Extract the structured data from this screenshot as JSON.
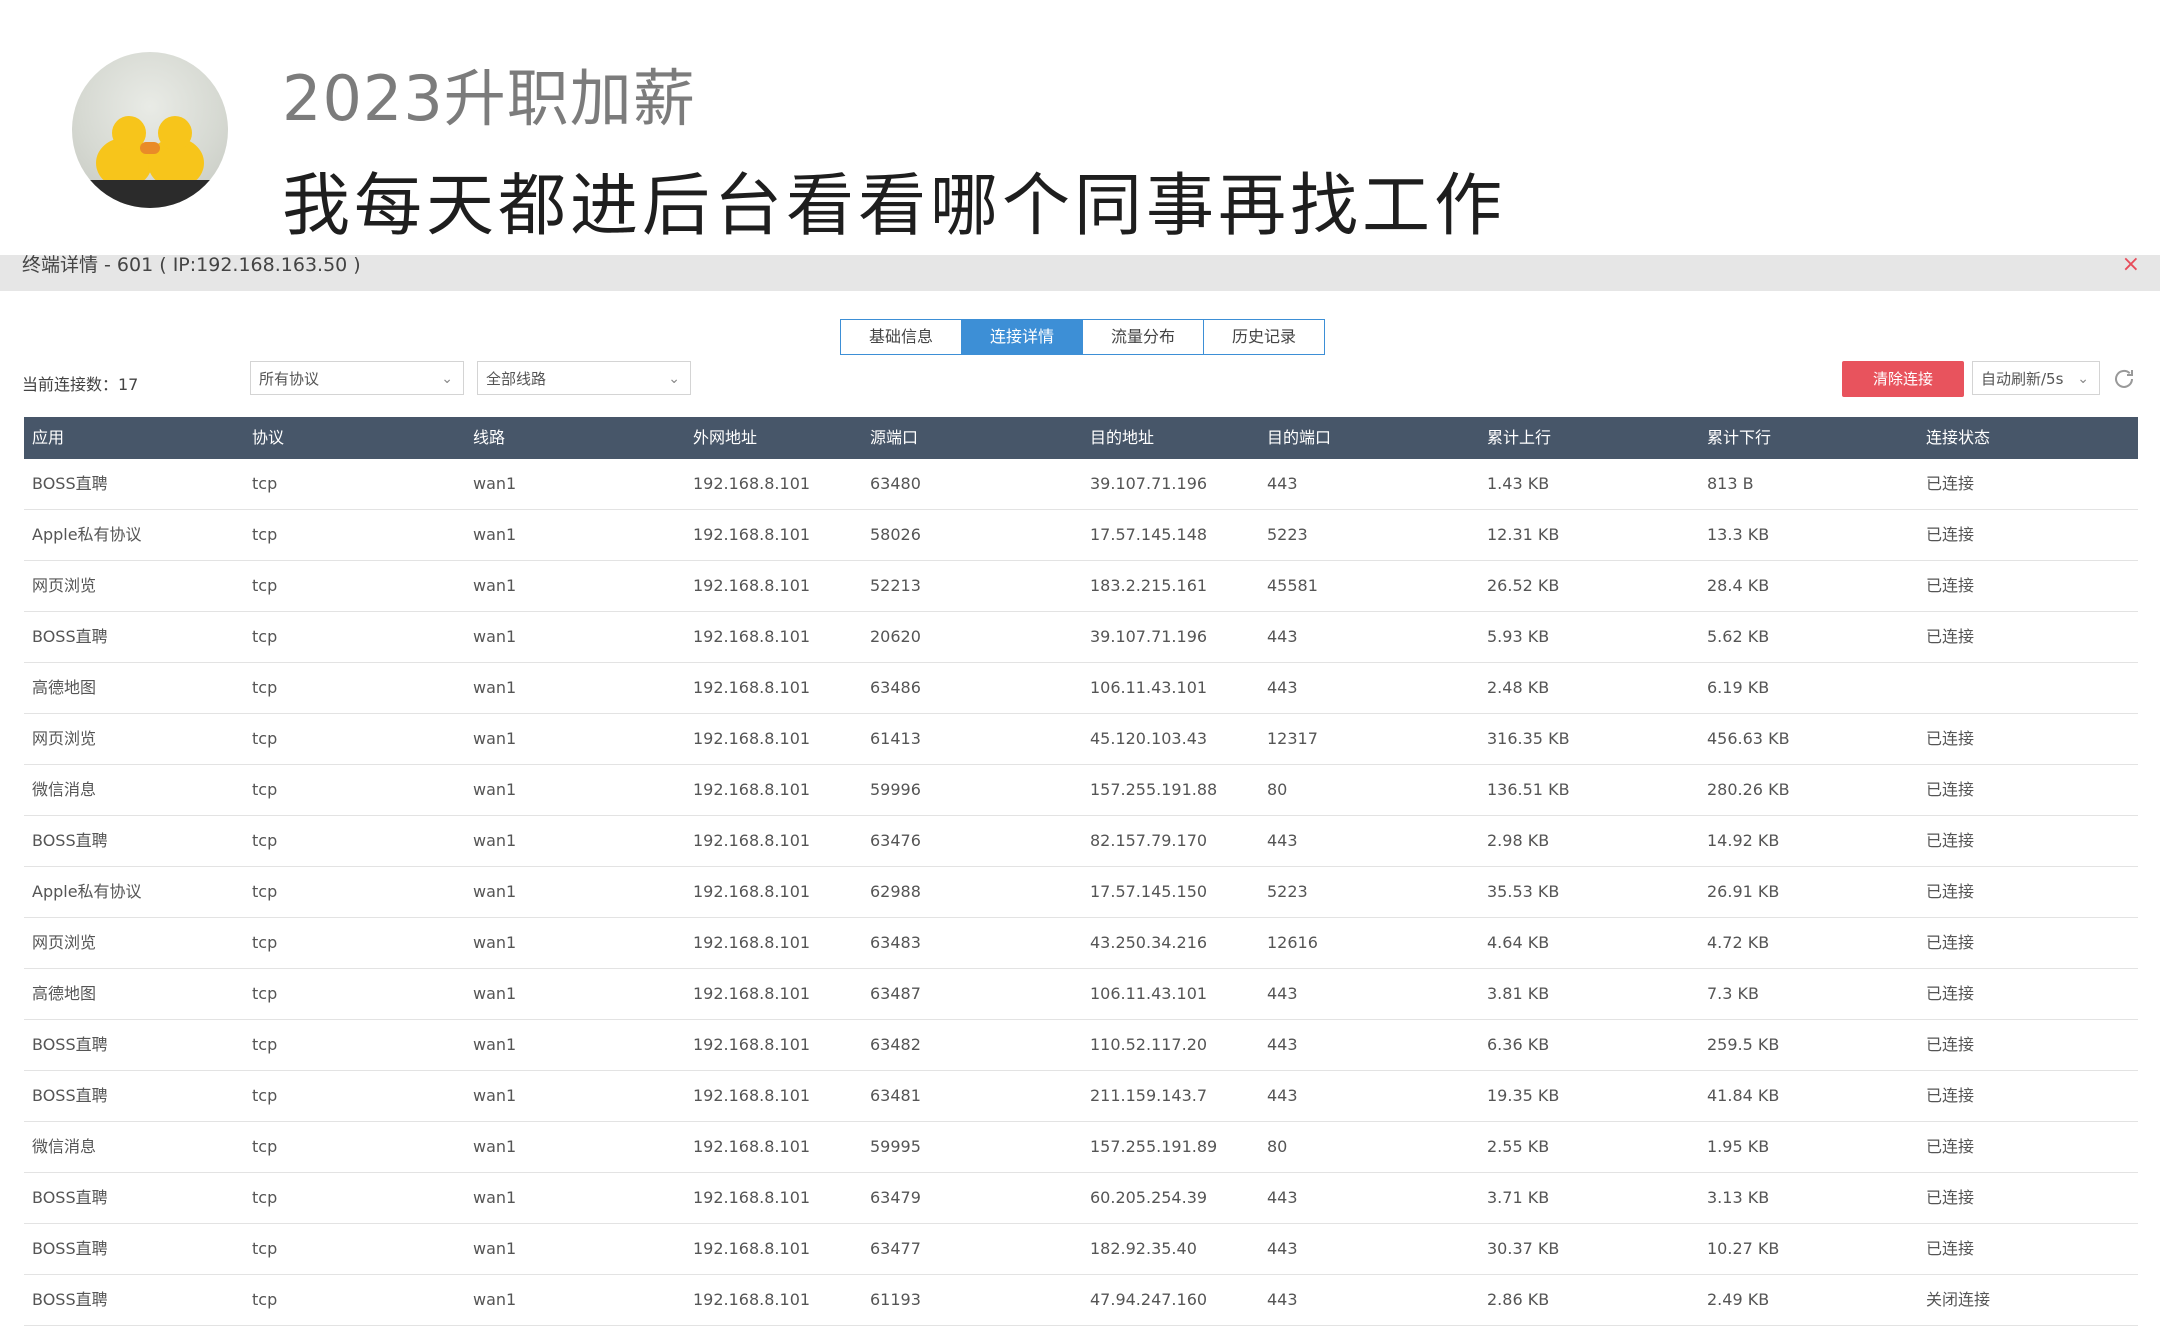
{
  "post": {
    "username": "2023升职加薪",
    "text": "我每天都进后台看看哪个同事再找工作"
  },
  "modal": {
    "title": "终端详情 - 601 ( IP:192.168.163.50 )",
    "close_glyph": "×"
  },
  "tabs": [
    "基础信息",
    "连接详情",
    "流量分布",
    "历史记录"
  ],
  "active_tab": "连接详情",
  "toolbar": {
    "conn_count": "当前连接数：17",
    "protocol_select": "所有协议",
    "line_select": "全部线路",
    "clear_button": "清除连接",
    "refresh_select": "自动刷新/5s"
  },
  "icons": {
    "chevron": "chevron-down-icon",
    "refresh": "refresh-icon",
    "close": "close-icon"
  },
  "colors": {
    "header_bg": "#475669",
    "tab_active": "#3d8fd6",
    "clear_btn": "#e8535d",
    "close": "#e74c5a"
  },
  "table": {
    "columns": [
      "应用",
      "协议",
      "线路",
      "外网地址",
      "源端口",
      "目的地址",
      "目的端口",
      "累计上行",
      "累计下行",
      "连接状态"
    ],
    "rows": [
      [
        "BOSS直聘",
        "tcp",
        "wan1",
        "192.168.8.101",
        "63480",
        "39.107.71.196",
        "443",
        "1.43 KB",
        "813 B",
        "已连接"
      ],
      [
        "Apple私有协议",
        "tcp",
        "wan1",
        "192.168.8.101",
        "58026",
        "17.57.145.148",
        "5223",
        "12.31 KB",
        "13.3 KB",
        "已连接"
      ],
      [
        "网页浏览",
        "tcp",
        "wan1",
        "192.168.8.101",
        "52213",
        "183.2.215.161",
        "45581",
        "26.52 KB",
        "28.4 KB",
        "已连接"
      ],
      [
        "BOSS直聘",
        "tcp",
        "wan1",
        "192.168.8.101",
        "20620",
        "39.107.71.196",
        "443",
        "5.93 KB",
        "5.62 KB",
        "已连接"
      ],
      [
        "高德地图",
        "tcp",
        "wan1",
        "192.168.8.101",
        "63486",
        "106.11.43.101",
        "443",
        "2.48 KB",
        "6.19 KB",
        ""
      ],
      [
        "网页浏览",
        "tcp",
        "wan1",
        "192.168.8.101",
        "61413",
        "45.120.103.43",
        "12317",
        "316.35 KB",
        "456.63 KB",
        "已连接"
      ],
      [
        "微信消息",
        "tcp",
        "wan1",
        "192.168.8.101",
        "59996",
        "157.255.191.88",
        "80",
        "136.51 KB",
        "280.26 KB",
        "已连接"
      ],
      [
        "BOSS直聘",
        "tcp",
        "wan1",
        "192.168.8.101",
        "63476",
        "82.157.79.170",
        "443",
        "2.98 KB",
        "14.92 KB",
        "已连接"
      ],
      [
        "Apple私有协议",
        "tcp",
        "wan1",
        "192.168.8.101",
        "62988",
        "17.57.145.150",
        "5223",
        "35.53 KB",
        "26.91 KB",
        "已连接"
      ],
      [
        "网页浏览",
        "tcp",
        "wan1",
        "192.168.8.101",
        "63483",
        "43.250.34.216",
        "12616",
        "4.64 KB",
        "4.72 KB",
        "已连接"
      ],
      [
        "高德地图",
        "tcp",
        "wan1",
        "192.168.8.101",
        "63487",
        "106.11.43.101",
        "443",
        "3.81 KB",
        "7.3 KB",
        "已连接"
      ],
      [
        "BOSS直聘",
        "tcp",
        "wan1",
        "192.168.8.101",
        "63482",
        "110.52.117.20",
        "443",
        "6.36 KB",
        "259.5 KB",
        "已连接"
      ],
      [
        "BOSS直聘",
        "tcp",
        "wan1",
        "192.168.8.101",
        "63481",
        "211.159.143.7",
        "443",
        "19.35 KB",
        "41.84 KB",
        "已连接"
      ],
      [
        "微信消息",
        "tcp",
        "wan1",
        "192.168.8.101",
        "59995",
        "157.255.191.89",
        "80",
        "2.55 KB",
        "1.95 KB",
        "已连接"
      ],
      [
        "BOSS直聘",
        "tcp",
        "wan1",
        "192.168.8.101",
        "63479",
        "60.205.254.39",
        "443",
        "3.71 KB",
        "3.13 KB",
        "已连接"
      ],
      [
        "BOSS直聘",
        "tcp",
        "wan1",
        "192.168.8.101",
        "63477",
        "182.92.35.40",
        "443",
        "30.37 KB",
        "10.27 KB",
        "已连接"
      ],
      [
        "BOSS直聘",
        "tcp",
        "wan1",
        "192.168.8.101",
        "61193",
        "47.94.247.160",
        "443",
        "2.86 KB",
        "2.49 KB",
        "关闭连接"
      ]
    ]
  }
}
